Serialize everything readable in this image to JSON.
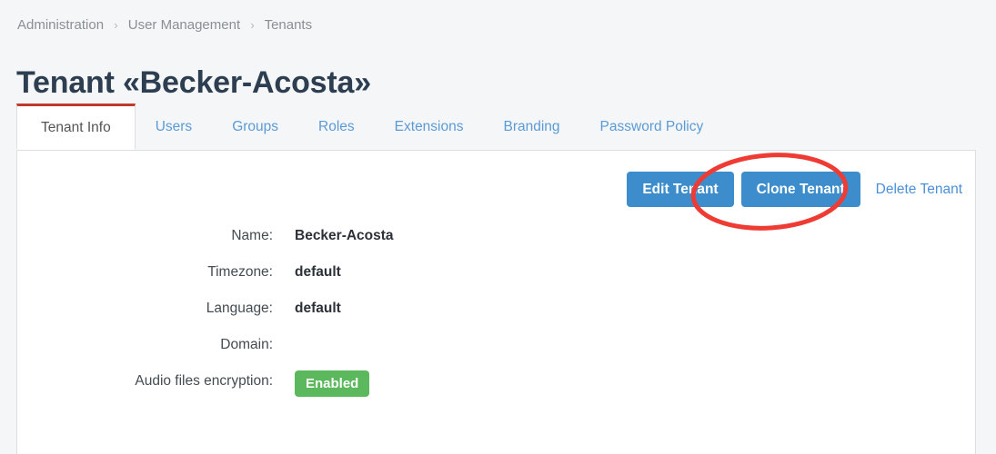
{
  "breadcrumb": {
    "items": [
      "Administration",
      "User Management",
      "Tenants"
    ],
    "separator": "›"
  },
  "page": {
    "title": "Tenant «Becker-Acosta»"
  },
  "tabs": [
    {
      "label": "Tenant Info",
      "active": true
    },
    {
      "label": "Users",
      "active": false
    },
    {
      "label": "Groups",
      "active": false
    },
    {
      "label": "Roles",
      "active": false
    },
    {
      "label": "Extensions",
      "active": false
    },
    {
      "label": "Branding",
      "active": false
    },
    {
      "label": "Password Policy",
      "active": false
    }
  ],
  "actions": {
    "edit_label": "Edit Tenant",
    "clone_label": "Clone Tenant",
    "delete_label": "Delete Tenant"
  },
  "details": [
    {
      "label": "Name:",
      "value": "Becker-Acosta",
      "type": "text"
    },
    {
      "label": "Timezone:",
      "value": "default",
      "type": "text"
    },
    {
      "label": "Language:",
      "value": "default",
      "type": "text"
    },
    {
      "label": "Domain:",
      "value": "",
      "type": "text"
    },
    {
      "label": "Audio files encryption:",
      "value": "Enabled",
      "type": "badge"
    }
  ],
  "colors": {
    "page_background": "#f5f6f7",
    "panel_background": "#ffffff",
    "primary_button": "#3d8dcc",
    "link": "#4a90d9",
    "active_tab_accent": "#c0392b",
    "badge_enabled": "#5cb85c",
    "title": "#2c3e50",
    "breadcrumb": "#8a8f94",
    "annotation": "#ee3b33"
  },
  "annotation": {
    "shape": "ellipse",
    "target": "Clone Tenant",
    "color": "#ee3b33"
  }
}
